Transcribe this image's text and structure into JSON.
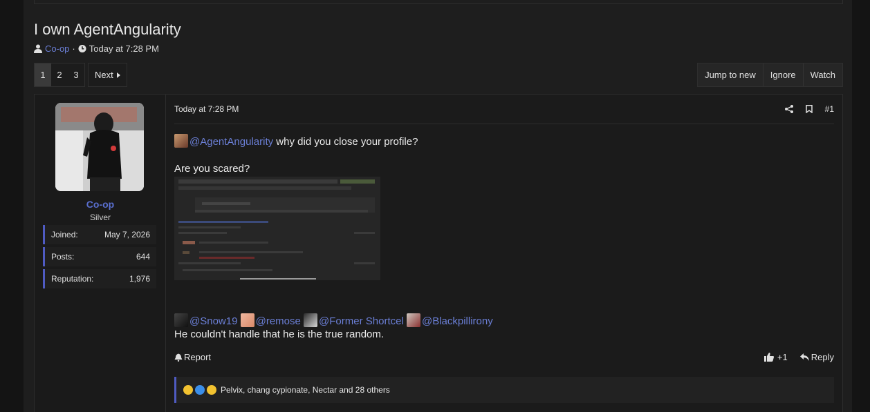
{
  "thread": {
    "title": "I own AgentAngularity",
    "author": "Co-op",
    "separator": "·",
    "time": "Today at 7:28 PM"
  },
  "pagination": {
    "pages": [
      "1",
      "2",
      "3"
    ],
    "active": "1",
    "next_label": "Next"
  },
  "thread_actions": [
    "Jump to new",
    "Ignore",
    "Watch"
  ],
  "user": {
    "name": "Co-op",
    "title": "Silver",
    "stats": [
      {
        "label": "Joined:",
        "value": "May 7, 2026"
      },
      {
        "label": "Posts:",
        "value": "644"
      },
      {
        "label": "Reputation:",
        "value": "1,976"
      }
    ]
  },
  "post": {
    "time": "Today at 7:28 PM",
    "number": "#1",
    "line1_mention": "@AgentAngularity",
    "line1_text": " why did you close your profile?",
    "line2": "Are you scared?",
    "mentions": [
      "@Snow19",
      "@remose",
      "@Former Shortcel",
      "@Blackpillirony"
    ],
    "line3": "He couldn't handle that he is the true random.",
    "report_label": "Report",
    "plus_one": "+1",
    "reply_label": "Reply",
    "reactions_text": "Pelvix, chang cypionate, Nectar and 28 others"
  },
  "colors": {
    "accent": "#4f5bc2",
    "link": "#6b7fd6"
  },
  "icons": [
    "user-icon",
    "clock-icon",
    "share-icon",
    "bookmark-icon",
    "bell-icon",
    "thumbs-up-icon",
    "reply-icon"
  ]
}
